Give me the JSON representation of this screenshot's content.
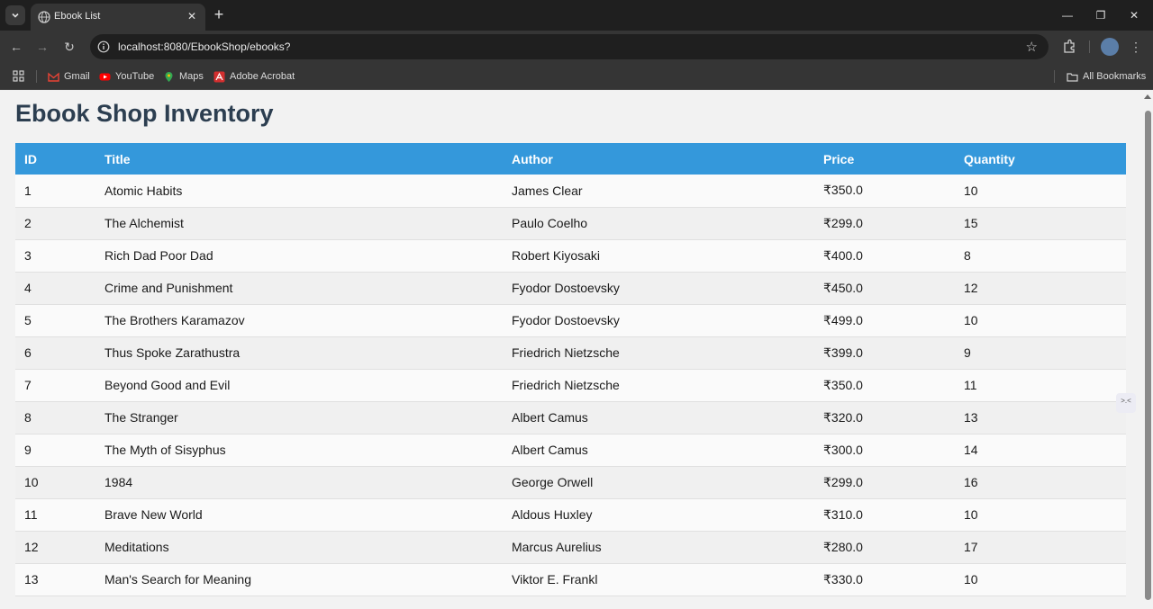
{
  "browser": {
    "tab_title": "Ebook List",
    "url": "localhost:8080/EbookShop/ebooks?",
    "bookmarks": [
      {
        "label": "Gmail",
        "icon": "gmail-icon"
      },
      {
        "label": "YouTube",
        "icon": "youtube-icon"
      },
      {
        "label": "Maps",
        "icon": "maps-icon"
      },
      {
        "label": "Adobe Acrobat",
        "icon": "acrobat-icon"
      }
    ],
    "all_bookmarks_label": "All Bookmarks"
  },
  "page": {
    "title": "Ebook Shop Inventory",
    "columns": [
      "ID",
      "Title",
      "Author",
      "Price",
      "Quantity"
    ],
    "rows": [
      {
        "id": "1",
        "title": "Atomic Habits",
        "author": "James Clear",
        "price": "₹350.0",
        "quantity": "10"
      },
      {
        "id": "2",
        "title": "The Alchemist",
        "author": "Paulo Coelho",
        "price": "₹299.0",
        "quantity": "15"
      },
      {
        "id": "3",
        "title": "Rich Dad Poor Dad",
        "author": "Robert Kiyosaki",
        "price": "₹400.0",
        "quantity": "8"
      },
      {
        "id": "4",
        "title": "Crime and Punishment",
        "author": "Fyodor Dostoevsky",
        "price": "₹450.0",
        "quantity": "12"
      },
      {
        "id": "5",
        "title": "The Brothers Karamazov",
        "author": "Fyodor Dostoevsky",
        "price": "₹499.0",
        "quantity": "10"
      },
      {
        "id": "6",
        "title": "Thus Spoke Zarathustra",
        "author": "Friedrich Nietzsche",
        "price": "₹399.0",
        "quantity": "9"
      },
      {
        "id": "7",
        "title": "Beyond Good and Evil",
        "author": "Friedrich Nietzsche",
        "price": "₹350.0",
        "quantity": "11"
      },
      {
        "id": "8",
        "title": "The Stranger",
        "author": "Albert Camus",
        "price": "₹320.0",
        "quantity": "13"
      },
      {
        "id": "9",
        "title": "The Myth of Sisyphus",
        "author": "Albert Camus",
        "price": "₹300.0",
        "quantity": "14"
      },
      {
        "id": "10",
        "title": "1984",
        "author": "George Orwell",
        "price": "₹299.0",
        "quantity": "16"
      },
      {
        "id": "11",
        "title": "Brave New World",
        "author": "Aldous Huxley",
        "price": "₹310.0",
        "quantity": "10"
      },
      {
        "id": "12",
        "title": "Meditations",
        "author": "Marcus Aurelius",
        "price": "₹280.0",
        "quantity": "17"
      },
      {
        "id": "13",
        "title": "Man's Search for Meaning",
        "author": "Viktor E. Frankl",
        "price": "₹330.0",
        "quantity": "10"
      }
    ]
  },
  "colors": {
    "header_bg": "#3498db",
    "title_color": "#2c3e50"
  }
}
